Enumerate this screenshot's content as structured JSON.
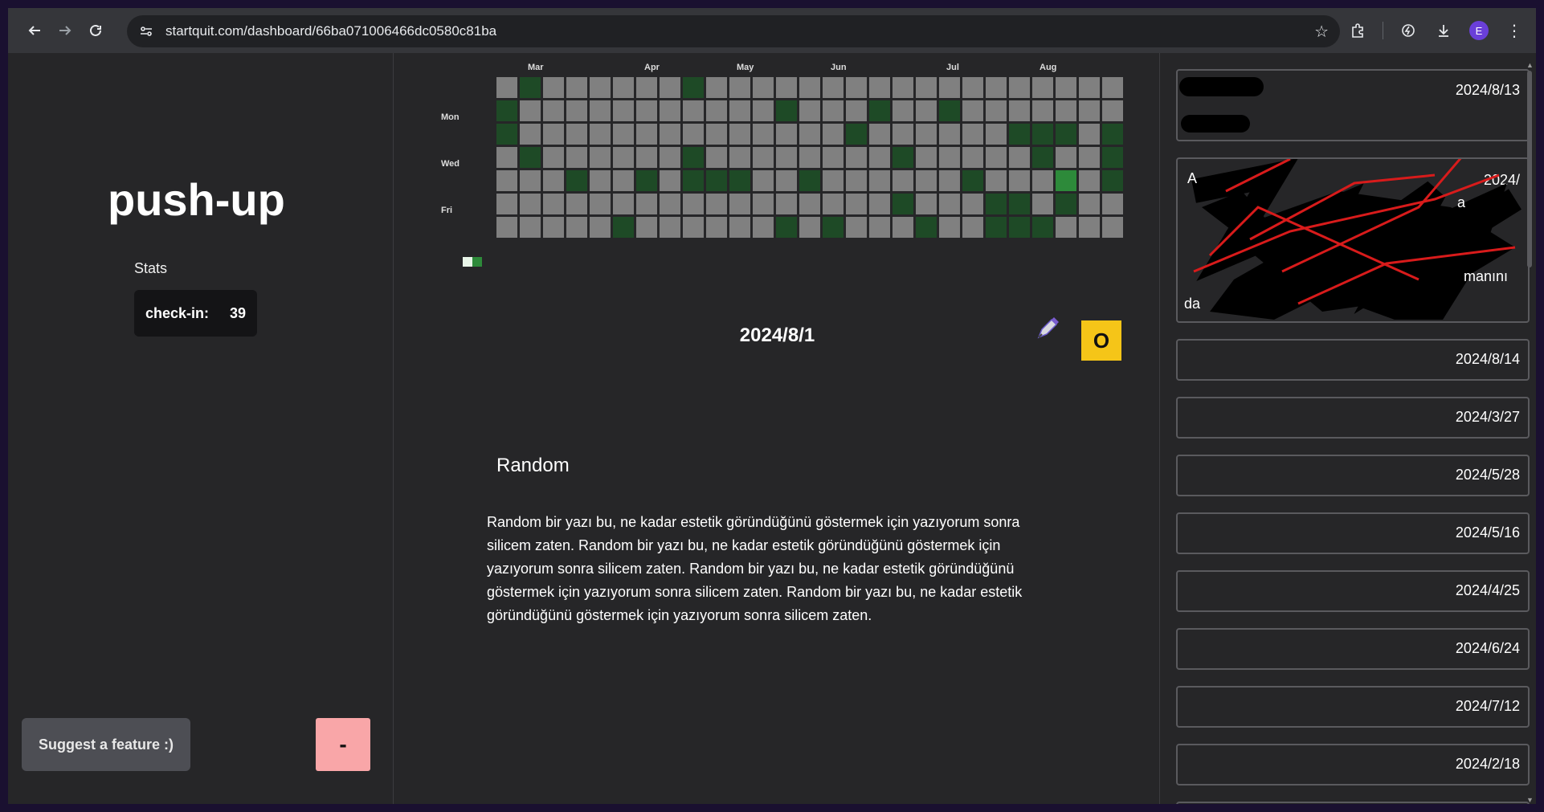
{
  "browser": {
    "url": "startquit.com/dashboard/66ba071006466dc0580c81ba",
    "profile_initial": "E",
    "icons": [
      "back-arrow-icon",
      "forward-arrow-icon",
      "reload-icon",
      "site-info-icon",
      "bookmark-star-icon",
      "extensions-icon",
      "performance-icon",
      "download-icon",
      "profile-avatar",
      "more-menu-icon"
    ]
  },
  "sidebar": {
    "habit_name": "push-up",
    "stats_label": "Stats",
    "checkin_label": "check-in:",
    "checkin_value": "39",
    "suggest_label": "Suggest a feature :)",
    "minus_label": "-"
  },
  "heatmap": {
    "months": [
      "Mar",
      "Apr",
      "May",
      "Jun",
      "Jul",
      "Aug"
    ],
    "days": [
      "Mon",
      "Wed",
      "Fri"
    ],
    "colors": {
      "empty": "#808080",
      "low": "#1e4a26",
      "high": "#2d8a3a",
      "legend_light": "#e8f5e8"
    },
    "weeks": 27,
    "filled": [
      [
        0,
        1
      ],
      [
        0,
        2
      ],
      [
        1,
        0
      ],
      [
        1,
        3
      ],
      [
        2,
        7
      ],
      [
        3,
        4
      ],
      [
        4,
        8
      ],
      [
        5,
        6
      ],
      [
        6,
        4
      ],
      [
        6,
        8
      ],
      [
        8,
        0
      ],
      [
        8,
        3
      ],
      [
        8,
        4
      ],
      [
        9,
        4
      ],
      [
        10,
        4
      ],
      [
        12,
        1
      ],
      [
        12,
        6
      ],
      [
        13,
        4
      ],
      [
        14,
        6
      ],
      [
        15,
        2
      ],
      [
        16,
        1
      ],
      [
        17,
        3
      ],
      [
        17,
        5
      ],
      [
        18,
        6
      ],
      [
        19,
        1
      ],
      [
        20,
        4
      ],
      [
        21,
        5
      ],
      [
        21,
        6
      ],
      [
        22,
        2
      ],
      [
        22,
        5
      ],
      [
        22,
        6
      ],
      [
        23,
        2
      ],
      [
        23,
        3
      ],
      [
        23,
        6
      ],
      [
        24,
        2
      ],
      [
        24,
        5
      ],
      [
        26,
        2
      ],
      [
        26,
        3
      ],
      [
        26,
        4
      ]
    ],
    "high": [
      [
        24,
        4
      ]
    ]
  },
  "entry": {
    "date": "2024/8/1",
    "o_label": "O",
    "title": "Random",
    "body": "Random bir yazı bu, ne kadar estetik göründüğünü göstermek için yazıyorum sonra silicem zaten. Random bir yazı bu, ne kadar estetik göründüğünü göstermek için yazıyorum sonra silicem zaten. Random bir yazı bu, ne kadar estetik göründüğünü göstermek için yazıyorum sonra silicem zaten. Random bir yazı bu, ne kadar estetik göründüğünü göstermek için yazıyorum sonra silicem zaten."
  },
  "entries_list": [
    {
      "date": "2024/8/13"
    },
    {
      "date": "2024/"
    },
    {
      "date": "2024/8/14"
    },
    {
      "date": "2024/3/27"
    },
    {
      "date": "2024/5/28"
    },
    {
      "date": "2024/5/16"
    },
    {
      "date": "2024/4/25"
    },
    {
      "date": "2024/6/24"
    },
    {
      "date": "2024/7/12"
    },
    {
      "date": "2024/2/18"
    }
  ]
}
